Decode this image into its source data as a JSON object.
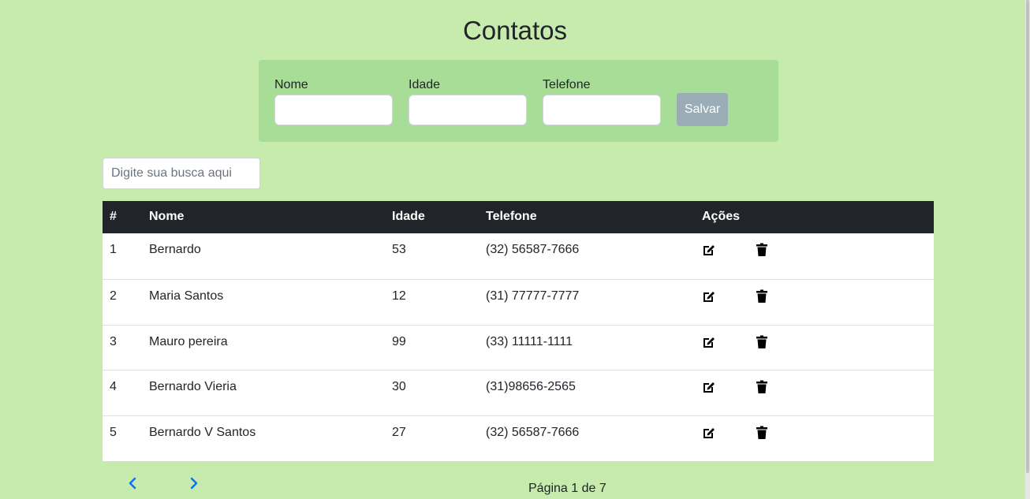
{
  "page": {
    "title": "Contatos"
  },
  "form": {
    "fields": [
      {
        "label": "Nome",
        "value": "",
        "placeholder": ""
      },
      {
        "label": "Idade",
        "value": "",
        "placeholder": ""
      },
      {
        "label": "Telefone",
        "value": "",
        "placeholder": ""
      }
    ],
    "save_label": "Salvar",
    "save_color": "#9aacb6"
  },
  "search": {
    "placeholder": "Digite sua busca aqui",
    "value": ""
  },
  "table": {
    "headers": [
      "#",
      "Nome",
      "Idade",
      "Telefone",
      "Ações"
    ],
    "rows": [
      {
        "id": "1",
        "nome": "Bernardo",
        "idade": "53",
        "telefone": "(32) 56587-7666"
      },
      {
        "id": "2",
        "nome": "Maria Santos",
        "idade": "12",
        "telefone": "(31) 77777-7777"
      },
      {
        "id": "3",
        "nome": "Mauro pereira",
        "idade": "99",
        "telefone": "(33) 11111-1111"
      },
      {
        "id": "4",
        "nome": "Bernardo Vieria",
        "idade": "30",
        "telefone": "(31)98656-2565"
      },
      {
        "id": "5",
        "nome": "Bernardo V Santos",
        "idade": "27",
        "telefone": "(32) 56587-7666"
      }
    ],
    "action_icons": [
      "edit-icon",
      "trash-icon"
    ]
  },
  "pagination": {
    "text": "Página 1 de 7",
    "prev_icon": "chevron-left-icon",
    "next_icon": "chevron-right-icon",
    "accent": "#0d6efd"
  },
  "colors": {
    "background": "#c6ebac",
    "form_panel": "#a7dd96",
    "table_header": "#212529"
  }
}
